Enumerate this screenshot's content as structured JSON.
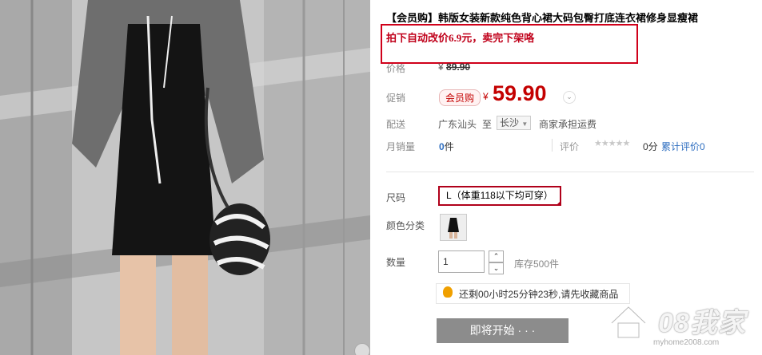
{
  "product": {
    "title": "【会员购】韩版女装新款纯色背心裙大码包臀打底连衣裙修身显瘦裙",
    "notice": "拍下自动改价6.9元，卖完下架咯"
  },
  "price": {
    "label": "价格",
    "currency": "¥",
    "original": "89.90"
  },
  "promo": {
    "label": "促销",
    "badge": "会员购",
    "currency": "¥",
    "value": "59.90",
    "arrow": "⌄"
  },
  "shipping": {
    "label": "配送",
    "from": "广东汕头",
    "to_word": "至",
    "to_city": "长沙",
    "fee": "商家承担运费"
  },
  "sales": {
    "label": "月销量",
    "count": "0",
    "unit": "件",
    "rating_label": "评价",
    "stars": "★★★★★",
    "score": "0分",
    "total_reviews": "累计评价0"
  },
  "size": {
    "label": "尺码",
    "selected": "L（体重118以下均可穿）"
  },
  "color_cat": {
    "label": "颜色分类"
  },
  "quantity": {
    "label": "数量",
    "value": "1",
    "up": "⌃",
    "down": "⌄",
    "stock": "库存500件"
  },
  "countdown": {
    "text": "还剩00小时25分钟23秒,请先收藏商品"
  },
  "buy": {
    "label": "即将开始 · · ·"
  },
  "watermark": {
    "text": "08我家",
    "url": "myhome2008.com"
  },
  "colors": {
    "accent_red": "#c40000",
    "link_blue": "#2e6ec0",
    "button_gray": "#8c8c8c"
  }
}
